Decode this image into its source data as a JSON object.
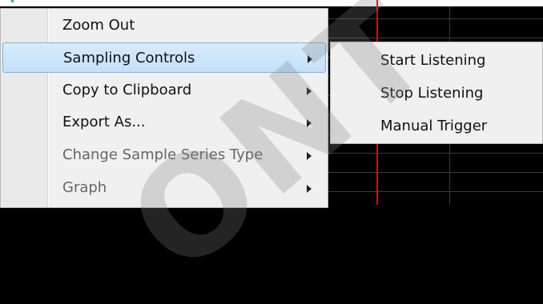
{
  "context_menu": {
    "items": [
      {
        "label": "Zoom Out",
        "has_submenu": false
      },
      {
        "label": "Sampling Controls",
        "has_submenu": true
      },
      {
        "label": "Copy to Clipboard",
        "has_submenu": true
      },
      {
        "label": "Export As...",
        "has_submenu": true
      },
      {
        "label": "Change Sample Series Type",
        "has_submenu": true
      },
      {
        "label": "Graph",
        "has_submenu": true
      }
    ]
  },
  "sampling_submenu": {
    "items": [
      {
        "label": "Start Listening"
      },
      {
        "label": "Stop Listening"
      },
      {
        "label": "Manual Trigger"
      }
    ]
  },
  "watermark": {
    "text": "ONT"
  },
  "colors": {
    "highlight": "#c4e0f9",
    "highlight_border": "#7cb3e6",
    "menu_bg": "#f0f0f0",
    "chart_bg": "#000000",
    "cursor_line": "#cc1111"
  }
}
